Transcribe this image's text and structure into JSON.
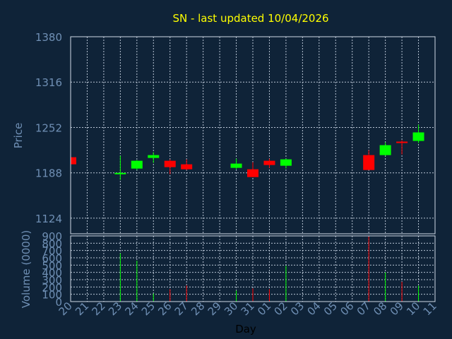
{
  "chart_data": {
    "type": "candlestick",
    "title": "SN - last updated 10/04/2026",
    "xlabel": "Day",
    "price_panel": {
      "ylabel": "Price",
      "ylim": [
        1102,
        1380
      ],
      "yticks": [
        1380,
        1316,
        1252,
        1188,
        1124
      ],
      "grid": true
    },
    "volume_panel": {
      "ylabel": "Volume (0000)",
      "ylim": [
        0,
        900
      ],
      "yticks": [
        900,
        800,
        700,
        600,
        500,
        400,
        300,
        200,
        100,
        0
      ],
      "grid": true
    },
    "x_ticks": [
      "20",
      "21",
      "22",
      "23",
      "24",
      "25",
      "26",
      "27",
      "28",
      "29",
      "30",
      "31",
      "01",
      "02",
      "03",
      "04",
      "05",
      "06",
      "07",
      "08",
      "09",
      "10",
      "11"
    ],
    "candles": [
      {
        "day": "20",
        "open": 1210,
        "high": 1212,
        "low": 1200,
        "close": 1200,
        "volume": 0
      },
      {
        "day": "23",
        "open": 1187,
        "high": 1212,
        "low": 1178,
        "close": 1187,
        "volume": 660
      },
      {
        "day": "24",
        "open": 1194,
        "high": 1206,
        "low": 1192,
        "close": 1205,
        "volume": 560
      },
      {
        "day": "25",
        "open": 1209,
        "high": 1217,
        "low": 1202,
        "close": 1213,
        "volume": 110
      },
      {
        "day": "26",
        "open": 1205,
        "high": 1207,
        "low": 1186,
        "close": 1196,
        "volume": 170
      },
      {
        "day": "27",
        "open": 1200,
        "high": 1207,
        "low": 1192,
        "close": 1193,
        "volume": 220
      },
      {
        "day": "30",
        "open": 1195,
        "high": 1208,
        "low": 1193,
        "close": 1201,
        "volume": 150
      },
      {
        "day": "31",
        "open": 1193,
        "high": 1203,
        "low": 1182,
        "close": 1182,
        "volume": 180
      },
      {
        "day": "01",
        "open": 1205,
        "high": 1208,
        "low": 1195,
        "close": 1199,
        "volume": 170
      },
      {
        "day": "02",
        "open": 1198,
        "high": 1208,
        "low": 1194,
        "close": 1207,
        "volume": 490
      },
      {
        "day": "07",
        "open": 1213,
        "high": 1220,
        "low": 1193,
        "close": 1192,
        "volume": 890
      },
      {
        "day": "08",
        "open": 1213,
        "high": 1231,
        "low": 1212,
        "close": 1227,
        "volume": 400
      },
      {
        "day": "09",
        "open": 1231,
        "high": 1234,
        "low": 1214,
        "close": 1230,
        "volume": 270
      },
      {
        "day": "10",
        "open": 1233,
        "high": 1256,
        "low": 1230,
        "close": 1245,
        "volume": 220
      }
    ],
    "colors": {
      "background": "#0f2338",
      "plot_border": "#cfd8e6",
      "grid": "#b8c4d4",
      "up": "#00ff00",
      "down": "#ff0000",
      "title": "#ffff00",
      "axis_text": "#6f8fb4",
      "xlabel": "#000000"
    }
  }
}
